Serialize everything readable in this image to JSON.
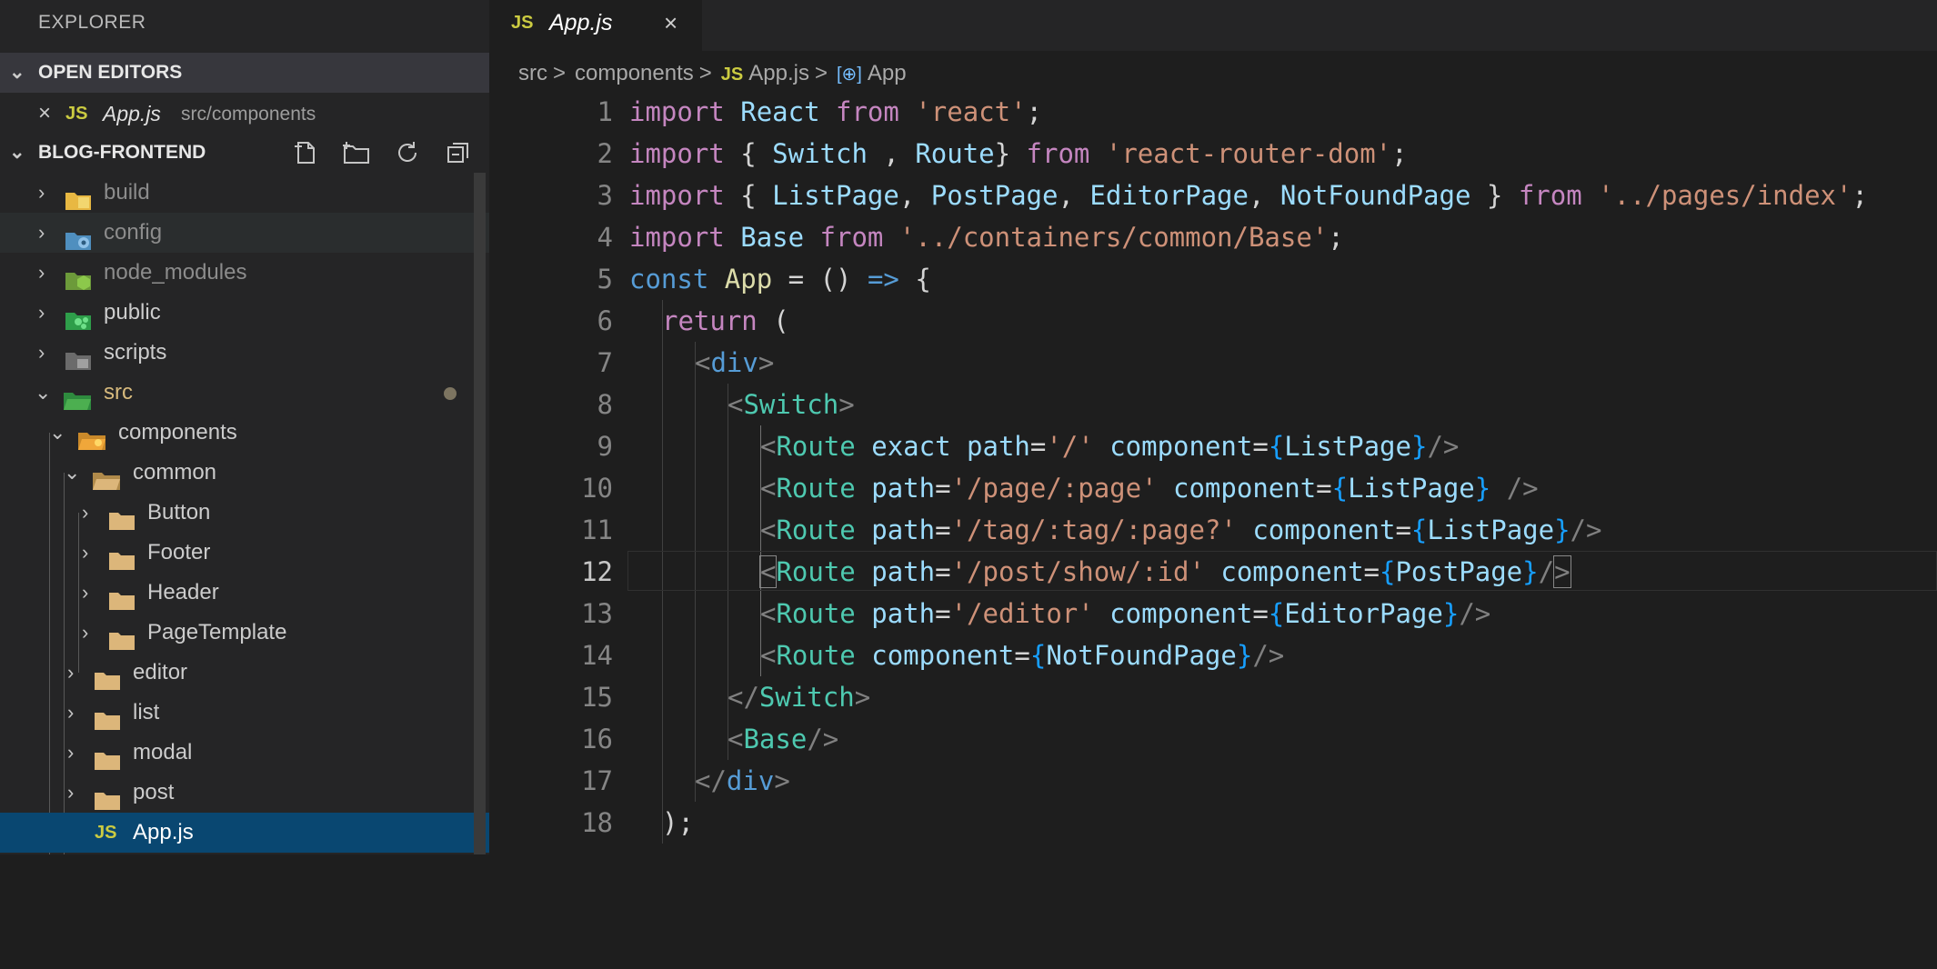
{
  "sidebar": {
    "title": "EXPLORER",
    "open_editors": {
      "label": "OPEN EDITORS",
      "item": {
        "close": "×",
        "file_icon": "JS",
        "name": "App.js",
        "path": "src/components"
      }
    },
    "project": {
      "label": "BLOG-FRONTEND",
      "actions": [
        "new-file-icon",
        "new-folder-icon",
        "refresh-icon",
        "collapse-all-icon"
      ]
    },
    "tree": [
      {
        "label": "build",
        "chev": "›",
        "icon": "folder-build-icon"
      },
      {
        "label": "config",
        "chev": "›",
        "icon": "folder-config-icon"
      },
      {
        "label": "node_modules",
        "chev": "›",
        "icon": "folder-node-icon"
      },
      {
        "label": "public",
        "chev": "›",
        "icon": "folder-public-icon"
      },
      {
        "label": "scripts",
        "chev": "›",
        "icon": "folder-scripts-icon"
      },
      {
        "label": "src",
        "chev": "⌄",
        "icon": "folder-src-icon"
      },
      {
        "label": "components",
        "chev": "⌄",
        "icon": "folder-components-icon"
      },
      {
        "label": "common",
        "chev": "⌄",
        "icon": "folder-open-icon"
      },
      {
        "label": "Button",
        "chev": "›",
        "icon": "folder-icon"
      },
      {
        "label": "Footer",
        "chev": "›",
        "icon": "folder-icon"
      },
      {
        "label": "Header",
        "chev": "›",
        "icon": "folder-icon"
      },
      {
        "label": "PageTemplate",
        "chev": "›",
        "icon": "folder-icon"
      },
      {
        "label": "editor",
        "chev": "›",
        "icon": "folder-icon"
      },
      {
        "label": "list",
        "chev": "›",
        "icon": "folder-icon"
      },
      {
        "label": "modal",
        "chev": "›",
        "icon": "folder-icon"
      },
      {
        "label": "post",
        "chev": "›",
        "icon": "folder-icon"
      },
      {
        "label": "App.js",
        "file_icon": "JS"
      }
    ]
  },
  "editor": {
    "tab": {
      "file_icon": "JS",
      "name": "App.js",
      "close": "×"
    },
    "breadcrumb": {
      "parts": [
        "src",
        "components"
      ],
      "sep": ">",
      "file_icon": "JS",
      "file": "App.js",
      "symbol_icon": "[⊕]",
      "symbol": "App"
    },
    "line_numbers": [
      "1",
      "2",
      "3",
      "4",
      "5",
      "6",
      "7",
      "8",
      "9",
      "10",
      "11",
      "12",
      "13",
      "14",
      "15",
      "16",
      "17",
      "18"
    ],
    "lines": {
      "l1": [
        "import",
        " ",
        "React",
        " ",
        "from",
        " ",
        "'react'",
        ";"
      ],
      "l2": [
        "import",
        " { ",
        "Switch",
        " , ",
        "Route",
        "} ",
        "from",
        " ",
        "'react-router-dom'",
        ";"
      ],
      "l3": [
        "import",
        " { ",
        "ListPage",
        ", ",
        "PostPage",
        ", ",
        "EditorPage",
        ", ",
        "NotFoundPage",
        " } ",
        "from",
        " ",
        "'../pages/index'",
        ";"
      ],
      "l4": [
        "import",
        " ",
        "Base",
        " ",
        "from",
        " ",
        "'../containers/common/Base'",
        ";"
      ],
      "l5": [
        "const",
        " ",
        "App",
        " = () ",
        "=>",
        " {"
      ],
      "l6": [
        "return",
        " ("
      ],
      "l7": [
        "<",
        "div",
        ">"
      ],
      "l8": [
        "<",
        "Switch",
        ">"
      ],
      "l9": [
        "<",
        "Route",
        " ",
        "exact",
        " ",
        "path",
        "=",
        "'/'",
        " ",
        "component",
        "=",
        "{",
        "ListPage",
        "}",
        "/>"
      ],
      "l10": [
        "<",
        "Route",
        " ",
        "path",
        "=",
        "'/page/:page'",
        " ",
        "component",
        "=",
        "{",
        "ListPage",
        "}",
        " />"
      ],
      "l11": [
        "<",
        "Route",
        " ",
        "path",
        "=",
        "'/tag/:tag/:page?'",
        " ",
        "component",
        "=",
        "{",
        "ListPage",
        "}",
        "/>"
      ],
      "l12": [
        "<",
        "Route",
        " ",
        "path",
        "=",
        "'/post/show/:id'",
        " ",
        "component",
        "=",
        "{",
        "PostPage",
        "}",
        "/",
        ">"
      ],
      "l13": [
        "<",
        "Route",
        " ",
        "path",
        "=",
        "'/editor'",
        " ",
        "component",
        "=",
        "{",
        "EditorPage",
        "}",
        "/>"
      ],
      "l14": [
        "<",
        "Route",
        " ",
        "component",
        "=",
        "{",
        "NotFoundPage",
        "}",
        "/>"
      ],
      "l15": [
        "</",
        "Switch",
        ">"
      ],
      "l16": [
        "<",
        "Base",
        "/>"
      ],
      "l17": [
        "</",
        "div",
        ">"
      ],
      "l18": [
        ");"
      ]
    }
  }
}
